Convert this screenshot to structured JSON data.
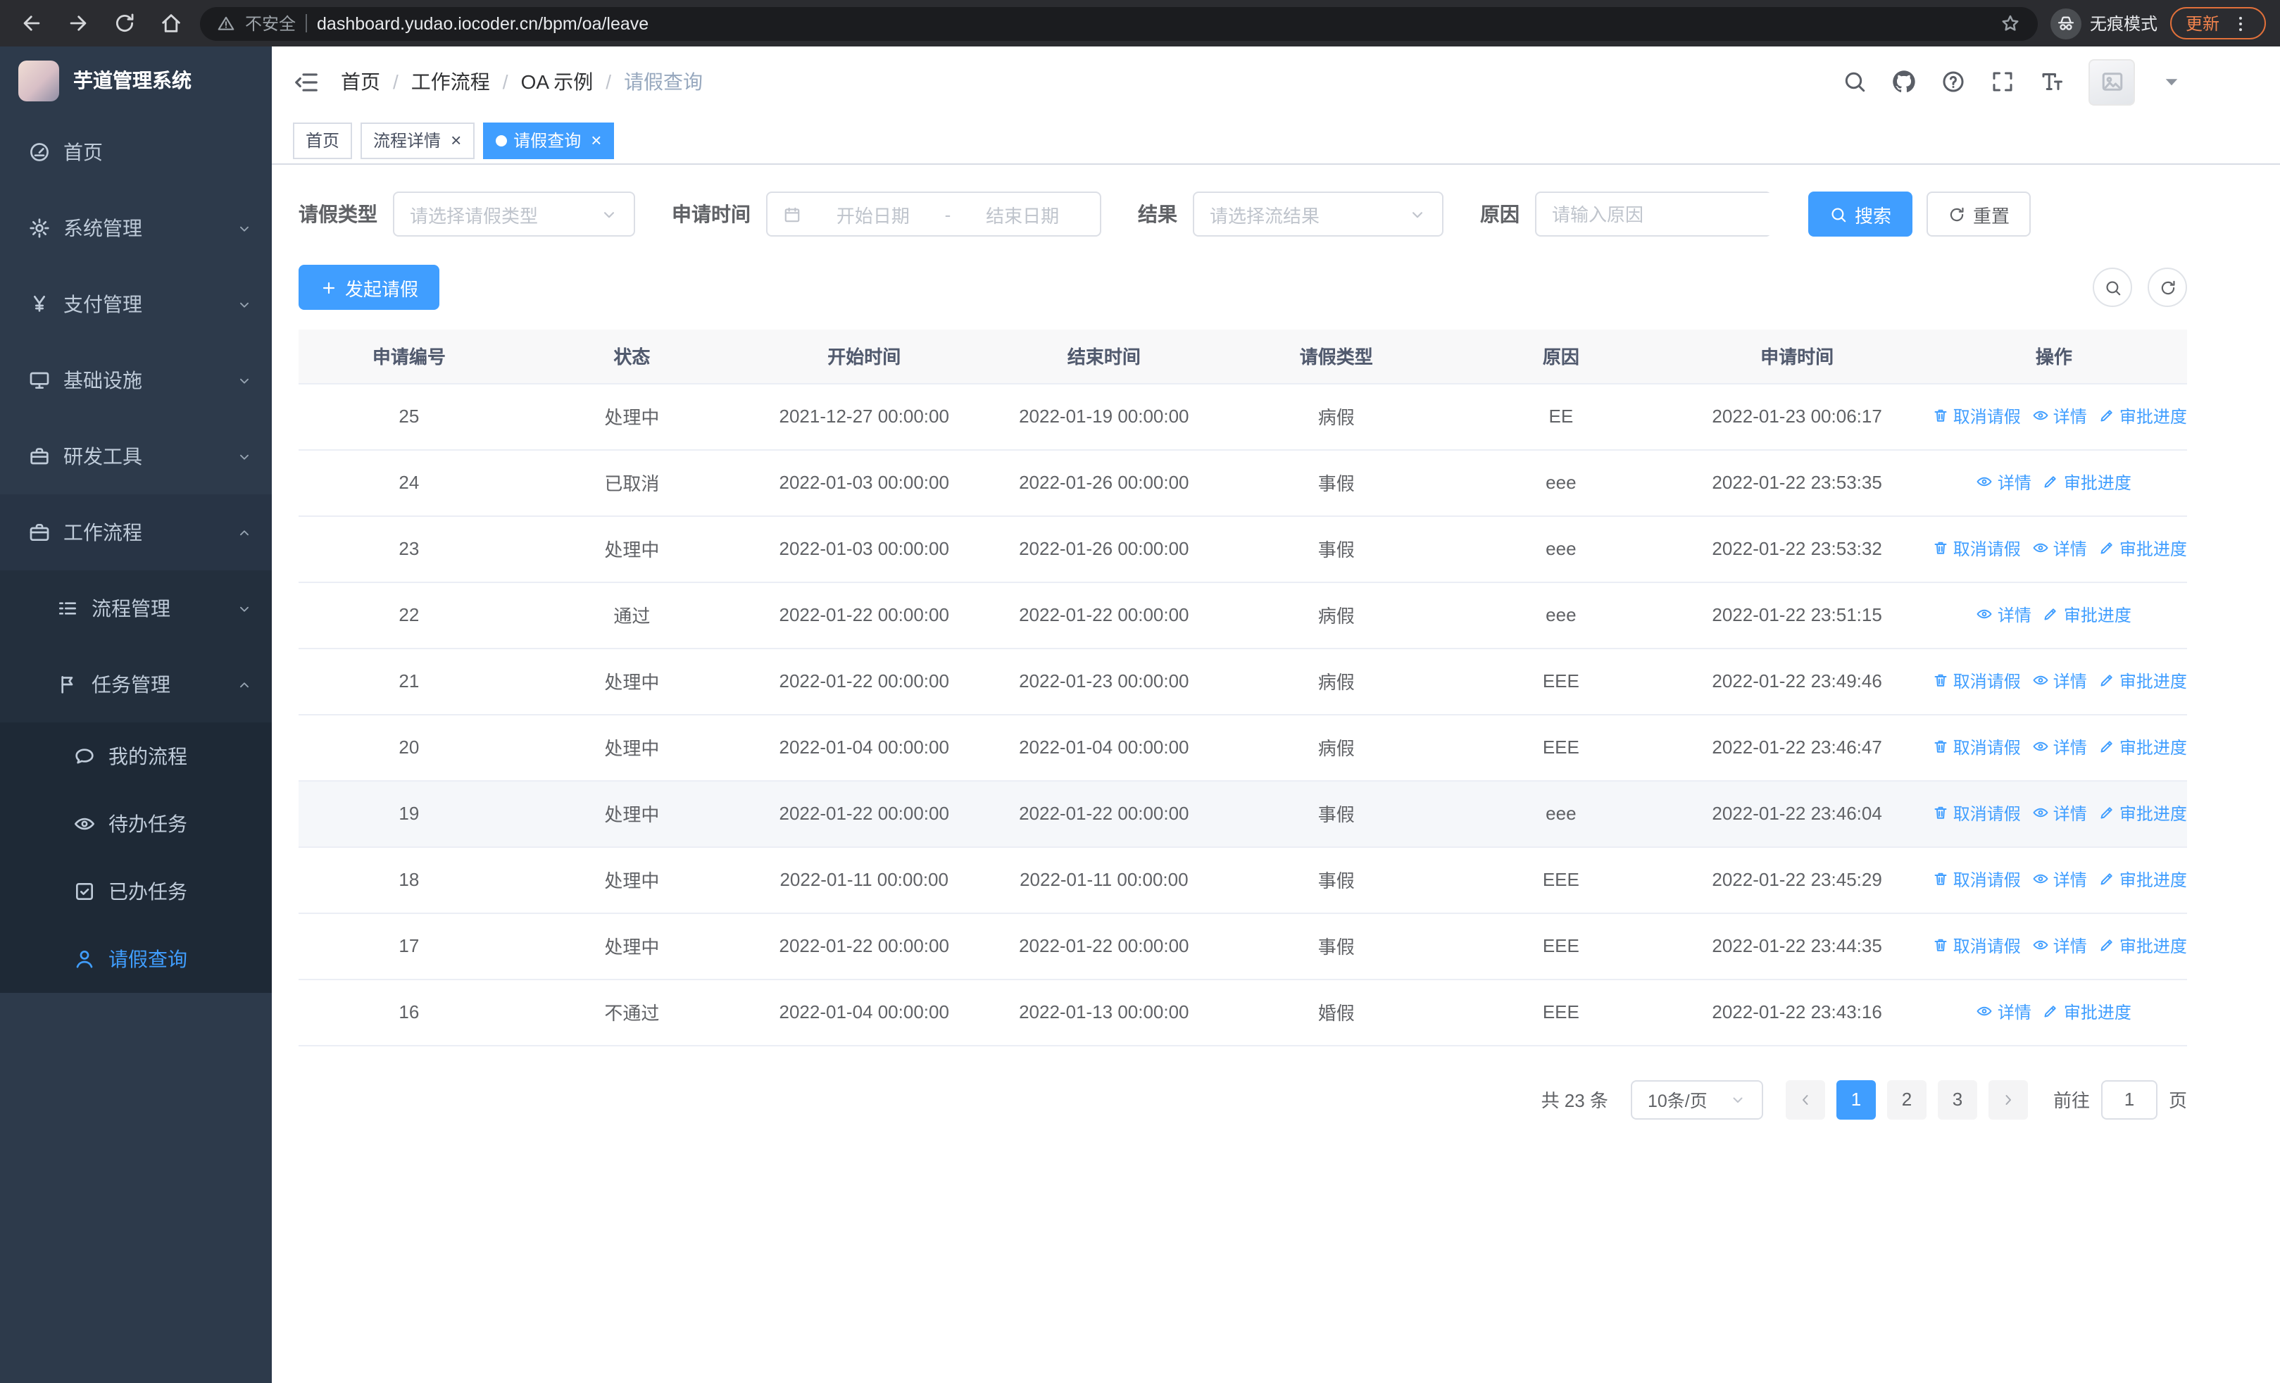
{
  "browser": {
    "security_label": "不安全",
    "url": "dashboard.yudao.iocoder.cn/bpm/oa/leave",
    "incognito_label": "无痕模式",
    "update_label": "更新"
  },
  "sidebar": {
    "logo_title": "芋道管理系统",
    "menu": [
      {
        "key": "home",
        "label": "首页",
        "icon": "gauge",
        "depth": 1
      },
      {
        "key": "system",
        "label": "系统管理",
        "icon": "gear",
        "depth": 1,
        "chevron": "down"
      },
      {
        "key": "payment",
        "label": "支付管理",
        "icon": "yen",
        "depth": 1,
        "chevron": "down"
      },
      {
        "key": "infrastructure",
        "label": "基础设施",
        "icon": "platform",
        "depth": 1,
        "chevron": "down"
      },
      {
        "key": "dev-tools",
        "label": "研发工具",
        "icon": "toolbox",
        "depth": 1,
        "chevron": "down"
      },
      {
        "key": "workflow",
        "label": "工作流程",
        "icon": "briefcase",
        "depth": 1,
        "chevron": "up",
        "open": true
      },
      {
        "key": "process-management",
        "label": "流程管理",
        "icon": "flow",
        "depth": 2,
        "chevron": "down"
      },
      {
        "key": "task-management",
        "label": "任务管理",
        "icon": "task",
        "depth": 2,
        "chevron": "up",
        "open": true
      },
      {
        "key": "my-process",
        "label": "我的流程",
        "icon": "chat",
        "depth": 3
      },
      {
        "key": "todo-tasks",
        "label": "待办任务",
        "icon": "eye",
        "depth": 3
      },
      {
        "key": "done-tasks",
        "label": "已办任务",
        "icon": "check-square",
        "depth": 3
      },
      {
        "key": "leave-query",
        "label": "请假查询",
        "icon": "user",
        "depth": 3,
        "active": true
      }
    ]
  },
  "header": {
    "breadcrumb": [
      {
        "key": "home",
        "label": "首页"
      },
      {
        "key": "workflow",
        "label": "工作流程"
      },
      {
        "key": "oa-example",
        "label": "OA 示例"
      },
      {
        "key": "leave-query",
        "label": "请假查询"
      }
    ]
  },
  "tabs": [
    {
      "key": "home",
      "label": "首页"
    },
    {
      "key": "process-detail",
      "label": "流程详情",
      "closable": true
    },
    {
      "key": "leave-query",
      "label": "请假查询",
      "closable": true,
      "active": true
    }
  ],
  "filters": {
    "leave_type_label": "请假类型",
    "leave_type_placeholder": "请选择请假类型",
    "apply_time_label": "申请时间",
    "date_start_placeholder": "开始日期",
    "date_separator": "-",
    "date_end_placeholder": "结束日期",
    "result_label": "结果",
    "result_placeholder": "请选择流结果",
    "reason_label": "原因",
    "reason_placeholder": "请输入原因",
    "search_button": "搜索",
    "reset_button": "重置"
  },
  "toolbar": {
    "create_button": "发起请假"
  },
  "table": {
    "columns": [
      "申请编号",
      "状态",
      "开始时间",
      "结束时间",
      "请假类型",
      "原因",
      "申请时间",
      "操作"
    ],
    "action_labels": {
      "cancel": "取消请假",
      "detail": "详情",
      "progress": "审批进度"
    },
    "rows": [
      {
        "id": "25",
        "status": "处理中",
        "start": "2021-12-27 00:00:00",
        "end": "2022-01-19 00:00:00",
        "type": "病假",
        "reason": "EE",
        "applied": "2022-01-23 00:06:17",
        "actions": [
          "cancel",
          "detail",
          "progress"
        ]
      },
      {
        "id": "24",
        "status": "已取消",
        "start": "2022-01-03 00:00:00",
        "end": "2022-01-26 00:00:00",
        "type": "事假",
        "reason": "eee",
        "applied": "2022-01-22 23:53:35",
        "actions": [
          "detail",
          "progress"
        ]
      },
      {
        "id": "23",
        "status": "处理中",
        "start": "2022-01-03 00:00:00",
        "end": "2022-01-26 00:00:00",
        "type": "事假",
        "reason": "eee",
        "applied": "2022-01-22 23:53:32",
        "actions": [
          "cancel",
          "detail",
          "progress"
        ]
      },
      {
        "id": "22",
        "status": "通过",
        "start": "2022-01-22 00:00:00",
        "end": "2022-01-22 00:00:00",
        "type": "病假",
        "reason": "eee",
        "applied": "2022-01-22 23:51:15",
        "actions": [
          "detail",
          "progress"
        ]
      },
      {
        "id": "21",
        "status": "处理中",
        "start": "2022-01-22 00:00:00",
        "end": "2022-01-23 00:00:00",
        "type": "病假",
        "reason": "EEE",
        "applied": "2022-01-22 23:49:46",
        "actions": [
          "cancel",
          "detail",
          "progress"
        ]
      },
      {
        "id": "20",
        "status": "处理中",
        "start": "2022-01-04 00:00:00",
        "end": "2022-01-04 00:00:00",
        "type": "病假",
        "reason": "EEE",
        "applied": "2022-01-22 23:46:47",
        "actions": [
          "cancel",
          "detail",
          "progress"
        ]
      },
      {
        "id": "19",
        "status": "处理中",
        "start": "2022-01-22 00:00:00",
        "end": "2022-01-22 00:00:00",
        "type": "事假",
        "reason": "eee",
        "applied": "2022-01-22 23:46:04",
        "actions": [
          "cancel",
          "detail",
          "progress"
        ],
        "highlight": true
      },
      {
        "id": "18",
        "status": "处理中",
        "start": "2022-01-11 00:00:00",
        "end": "2022-01-11 00:00:00",
        "type": "事假",
        "reason": "EEE",
        "applied": "2022-01-22 23:45:29",
        "actions": [
          "cancel",
          "detail",
          "progress"
        ]
      },
      {
        "id": "17",
        "status": "处理中",
        "start": "2022-01-22 00:00:00",
        "end": "2022-01-22 00:00:00",
        "type": "事假",
        "reason": "EEE",
        "applied": "2022-01-22 23:44:35",
        "actions": [
          "cancel",
          "detail",
          "progress"
        ]
      },
      {
        "id": "16",
        "status": "不通过",
        "start": "2022-01-04 00:00:00",
        "end": "2022-01-13 00:00:00",
        "type": "婚假",
        "reason": "EEE",
        "applied": "2022-01-22 23:43:16",
        "actions": [
          "detail",
          "progress"
        ]
      }
    ]
  },
  "pagination": {
    "total_label": "共 23 条",
    "page_size": "10条/页",
    "pages": [
      "1",
      "2",
      "3"
    ],
    "active_page": "1",
    "goto_label": "前往",
    "goto_value": "1",
    "goto_suffix": "页"
  },
  "theme": {
    "primary": "#409eff"
  }
}
